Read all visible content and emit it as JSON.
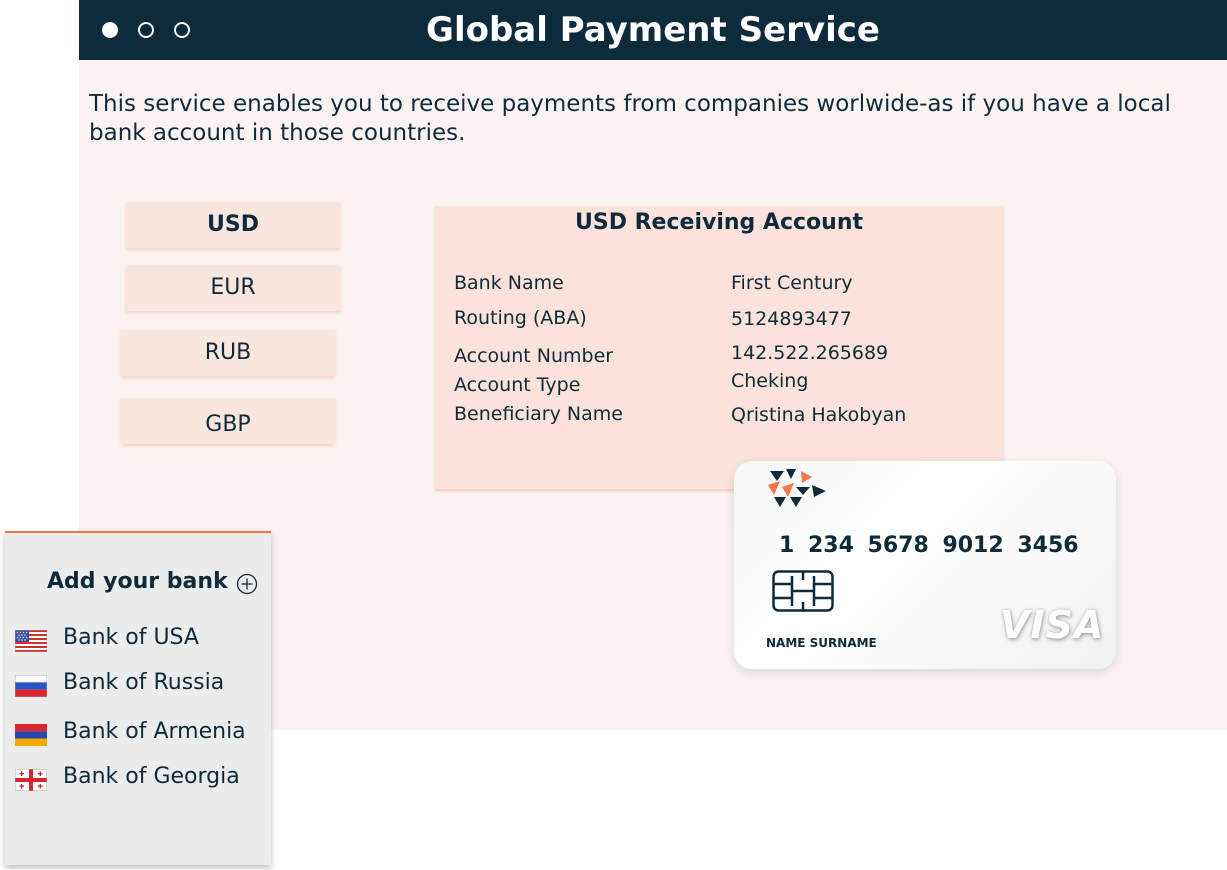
{
  "window": {
    "title": "Global Payment Service",
    "controls": [
      "dot-filled",
      "dot-hollow",
      "dot-hollow"
    ]
  },
  "intro": {
    "text": "This service enables you to receive payments from companies worlwide-as if you have a local bank account in those countries."
  },
  "currencies": [
    {
      "label": "USD",
      "selected": true
    },
    {
      "label": "EUR",
      "selected": false
    },
    {
      "label": "RUB",
      "selected": false
    },
    {
      "label": "GBP",
      "selected": false
    }
  ],
  "account": {
    "title": "USD Receiving Account",
    "fields": [
      {
        "label": "Bank Name",
        "value": "First Century"
      },
      {
        "label": "Routing (ABA)",
        "value": "5124893477"
      },
      {
        "label": "Account Number",
        "value": "142.522.265689"
      },
      {
        "label": "Account Type",
        "value": "Cheking"
      },
      {
        "label": "Beneficiary Name",
        "value": "Qristina Hakobyan"
      }
    ]
  },
  "card": {
    "number": "1 234 5678 9012 3456",
    "holder": "NAME SURNAME",
    "brand": "VISA",
    "logo_icon": "triangles-logo-icon",
    "chip_icon": "chip-icon"
  },
  "banks": {
    "add_label": "Add your bank",
    "add_icon": "plus-circle-icon",
    "items": [
      {
        "name": "Bank of USA",
        "flag": "us-flag-icon"
      },
      {
        "name": "Bank of Russia",
        "flag": "russia-flag-icon"
      },
      {
        "name": "Bank of Armenia",
        "flag": "armenia-flag-icon"
      },
      {
        "name": "Bank of Georgia",
        "flag": "georgia-flag-icon"
      }
    ]
  },
  "colors": {
    "titlebar": "#0e2b3c",
    "page_background": "#fbf3f1",
    "tab_background": "#fbe5df",
    "account_background": "#fbe3dc",
    "accent": "#f4774b",
    "text": "#0e2a3b",
    "bank_panel": "#ececec"
  }
}
